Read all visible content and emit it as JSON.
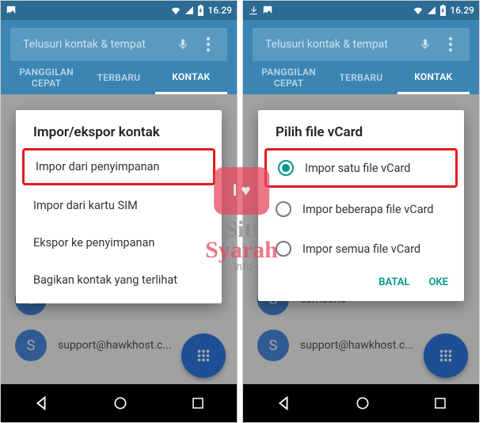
{
  "status": {
    "time": "16.29"
  },
  "search": {
    "placeholder": "Telusuri kontak & tempat"
  },
  "tabs": {
    "speed": "PANGGILAN CEPAT",
    "recent": "TERBARU",
    "contact": "KONTAK"
  },
  "contacts": [
    {
      "initial": "S",
      "name": "someone"
    },
    {
      "initial": "S",
      "name": "support@hawkhost.c..."
    }
  ],
  "dialog_left": {
    "title": "Impor/ekspor kontak",
    "options": [
      "Impor dari penyimpanan",
      "Impor dari kartu SIM",
      "Ekspor ke penyimpanan",
      "Bagikan kontak yang terlihat"
    ]
  },
  "dialog_right": {
    "title": "Pilih file vCard",
    "options": [
      "Impor satu file vCard",
      "Impor beberapa file vCard",
      "Impor semua file vCard"
    ],
    "cancel": "BATAL",
    "ok": "OKE"
  },
  "watermark": {
    "bubble": "I ♥",
    "line1": "Siti",
    "line2": "Syarah",
    "line3": ".info"
  }
}
